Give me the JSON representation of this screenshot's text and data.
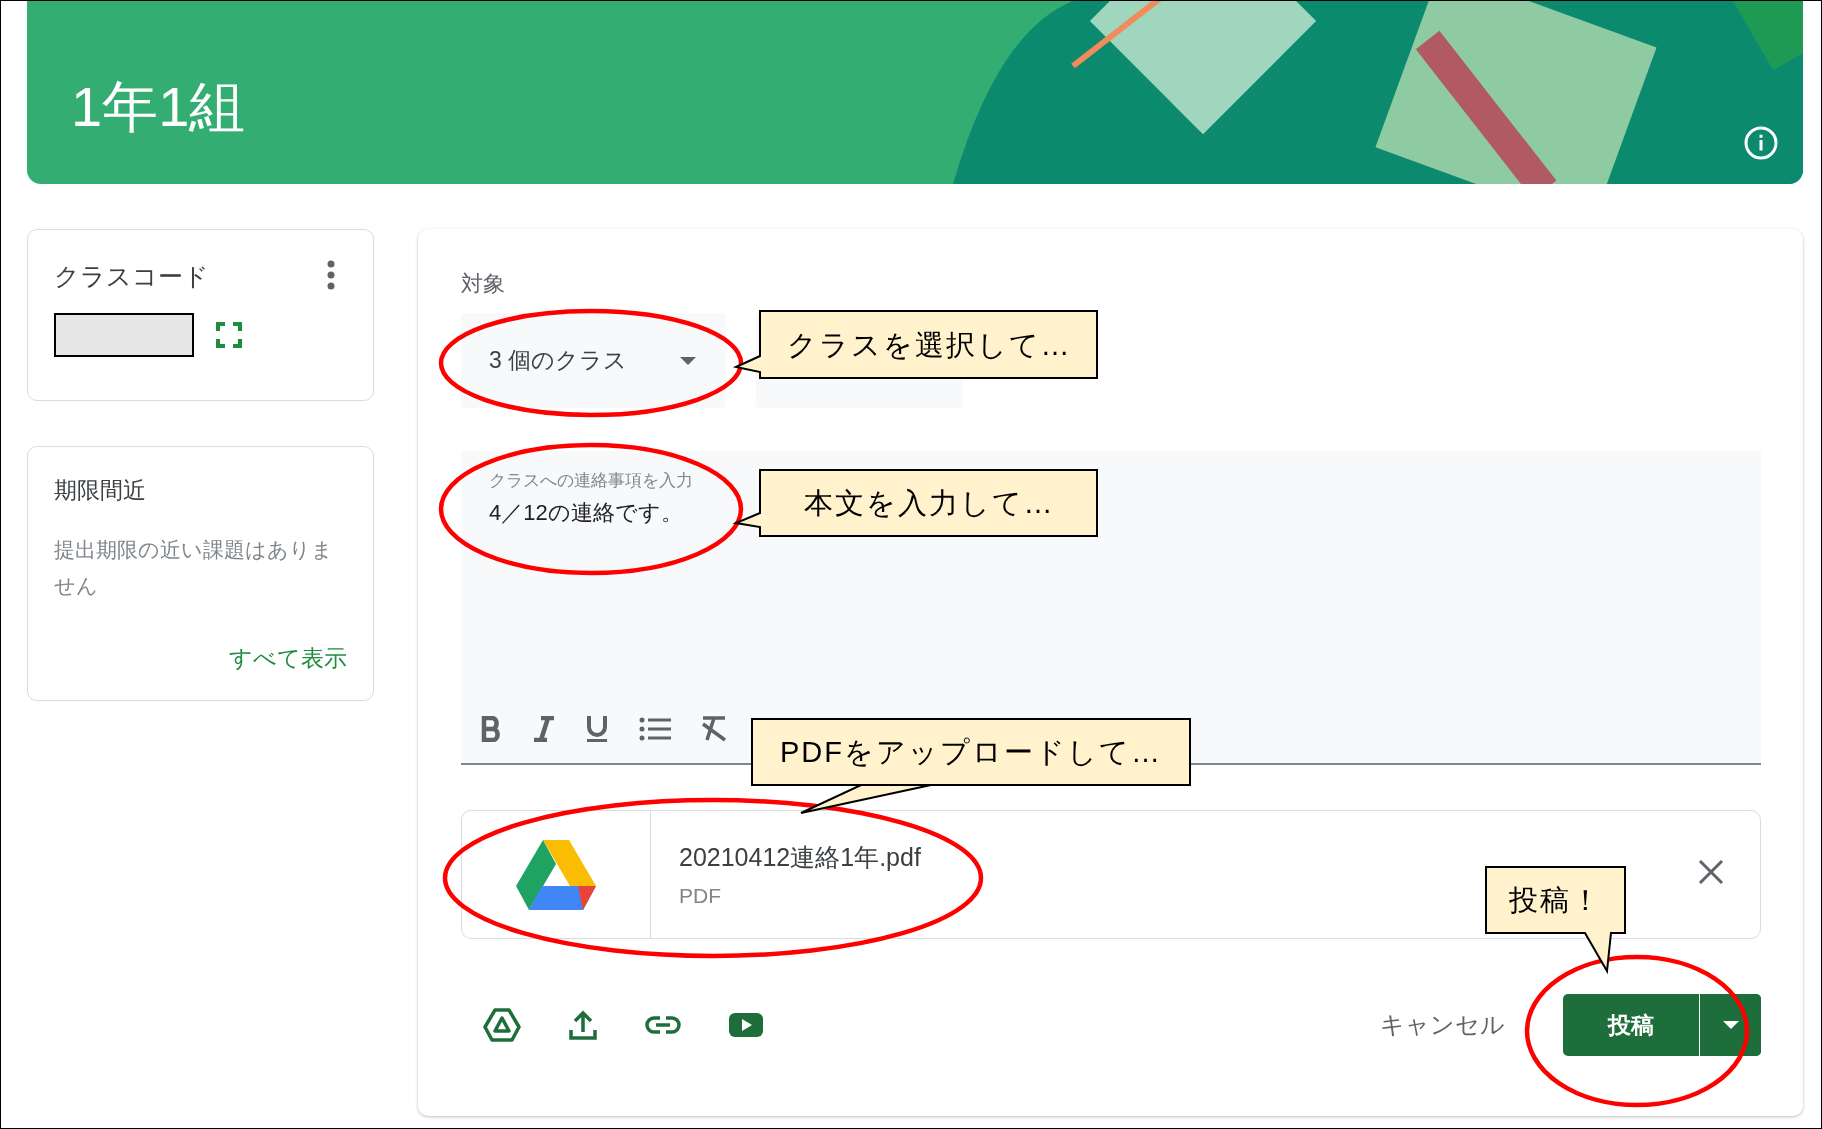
{
  "header": {
    "title": "1年1組"
  },
  "class_code_card": {
    "title": "クラスコード"
  },
  "upcoming_card": {
    "title": "期限間近",
    "message": "提出期限の近い課題はありません",
    "link": "すべて表示"
  },
  "composer": {
    "audience_label": "対象",
    "audience_dropdown": {
      "value": "3 個のクラス"
    },
    "body_field": {
      "placeholder": "クラスへの連絡事項を入力",
      "value": "4／12の連絡です。"
    },
    "attachment": {
      "name": "20210412連絡1年.pdf",
      "type": "PDF"
    },
    "cancel_button": "キャンセル",
    "post_button": "投稿"
  },
  "annotations": [
    {
      "text": "クラスを選択して…"
    },
    {
      "text": "本文を入力して…"
    },
    {
      "text": "PDFをアップロードして…"
    },
    {
      "text": "投稿！"
    }
  ]
}
